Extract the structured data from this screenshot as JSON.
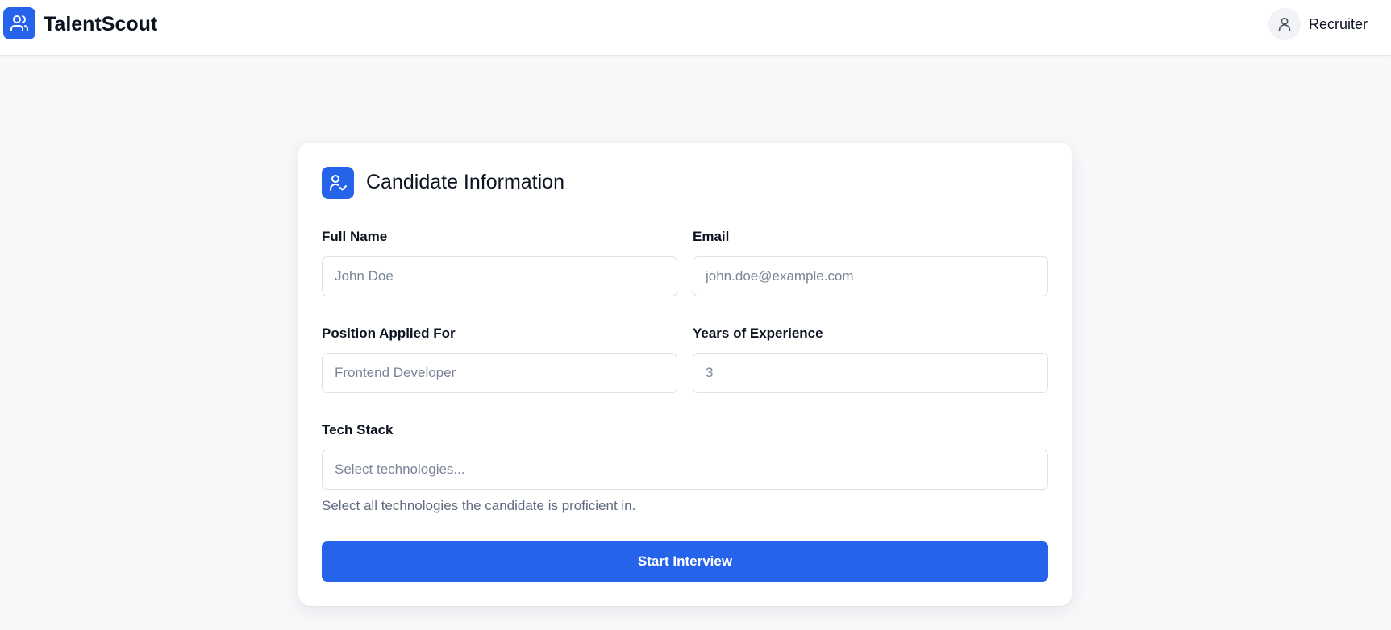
{
  "app": {
    "title": "TalentScout",
    "logo_icon": "users-icon",
    "brand_color": "#2563eb"
  },
  "user": {
    "role_label": "Recruiter",
    "avatar_icon": "user-icon"
  },
  "form": {
    "title": "Candidate Information",
    "title_icon": "user-check-icon",
    "fields": {
      "full_name": {
        "label": "Full Name",
        "placeholder": "John Doe",
        "value": ""
      },
      "email": {
        "label": "Email",
        "placeholder": "john.doe@example.com",
        "value": ""
      },
      "position": {
        "label": "Position Applied For",
        "placeholder": "Frontend Developer",
        "value": ""
      },
      "experience": {
        "label": "Years of Experience",
        "placeholder": "3",
        "value": ""
      },
      "tech_stack": {
        "label": "Tech Stack",
        "placeholder": "Select technologies...",
        "value": ""
      }
    },
    "helper_text": "Select all technologies the candidate is proficient in.",
    "submit_label": "Start Interview"
  }
}
